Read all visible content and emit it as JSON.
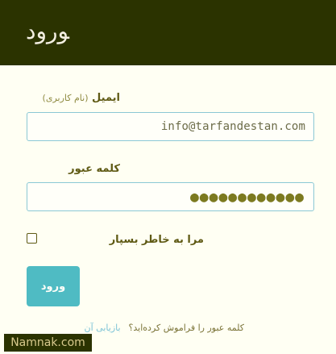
{
  "header": {
    "logo_text": "ﻮرود"
  },
  "form": {
    "email": {
      "label": "ایمیل",
      "hint": "(نام کاربری)",
      "value": "info@tarfandestan.com"
    },
    "password": {
      "label": "کلمه عبور",
      "value": "●●●●●●●●●●●●"
    },
    "remember": {
      "label": "مرا به خاطر بسپار"
    },
    "submit": {
      "label": "ورود"
    }
  },
  "footer": {
    "text": "کلمه عبور را فراموش کرده‌اید؟",
    "link": "بازیابی آن"
  },
  "watermark": {
    "text": "Namnak.com"
  },
  "colors": {
    "header_bg": "#2b3300",
    "page_bg": "#fffff3",
    "accent": "#4fbbc3",
    "text": "#5f5a14",
    "field_border": "#8bc8d5"
  }
}
